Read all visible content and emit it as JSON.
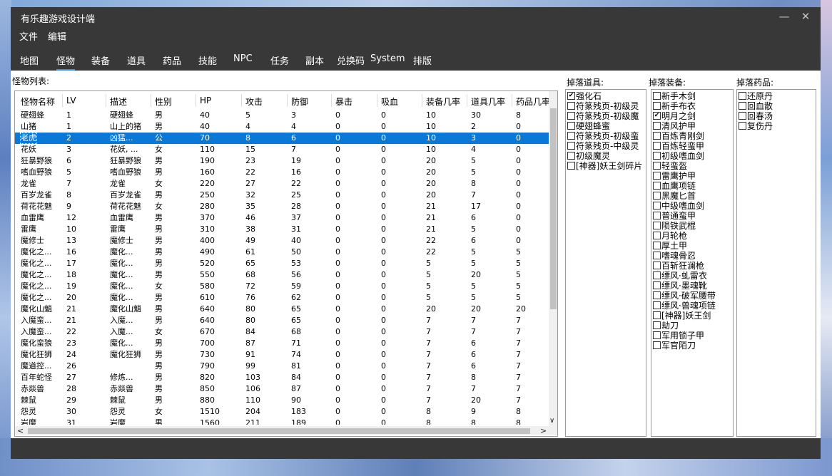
{
  "window": {
    "title": "有乐趣游戏设计端"
  },
  "menu": [
    "文件",
    "编辑"
  ],
  "tabs": [
    {
      "label": "地图",
      "active": false
    },
    {
      "label": "怪物",
      "active": true
    },
    {
      "label": "装备",
      "active": false
    },
    {
      "label": "道具",
      "active": false
    },
    {
      "label": "药品",
      "active": false
    },
    {
      "label": "技能",
      "active": false
    },
    {
      "label": "NPC",
      "active": false
    },
    {
      "label": "任务",
      "active": false
    },
    {
      "label": "副本",
      "active": false
    },
    {
      "label": "兑换码",
      "active": false
    },
    {
      "label": "System",
      "active": false
    },
    {
      "label": "排版",
      "active": false
    }
  ],
  "monster_list": {
    "label": "怪物列表:",
    "columns": [
      "怪物名称",
      "LV",
      "描述",
      "性别",
      "HP",
      "攻击",
      "防御",
      "暴击",
      "吸血",
      "装备几率",
      "道具几率",
      "药品几率"
    ],
    "selected_row": 2,
    "rows": [
      [
        "硬翅蜂",
        "1",
        "硬翅蜂",
        "男",
        "40",
        "5",
        "3",
        "0",
        "0",
        "10",
        "30",
        "8"
      ],
      [
        "山猪",
        "1",
        "山上的猪",
        "男",
        "40",
        "4",
        "4",
        "0",
        "0",
        "10",
        "2",
        "0"
      ],
      [
        "老虎",
        "2",
        "凶猛...",
        "公",
        "70",
        "8",
        "6",
        "0",
        "0",
        "10",
        "3",
        "0"
      ],
      [
        "花妖",
        "3",
        "花妖, ...",
        "女",
        "110",
        "15",
        "7",
        "0",
        "0",
        "10",
        "4",
        "0"
      ],
      [
        "狂暴野狼",
        "6",
        "狂暴野狼",
        "男",
        "190",
        "23",
        "19",
        "0",
        "0",
        "20",
        "5",
        "0"
      ],
      [
        "嗜血野狼",
        "5",
        "嗜血野狼",
        "男",
        "160",
        "22",
        "16",
        "0",
        "0",
        "20",
        "5",
        "0"
      ],
      [
        "龙雀",
        "7",
        "龙雀",
        "女",
        "220",
        "27",
        "22",
        "0",
        "0",
        "20",
        "8",
        "0"
      ],
      [
        "百岁龙雀",
        "8",
        "百岁龙雀",
        "男",
        "250",
        "32",
        "25",
        "0",
        "0",
        "20",
        "7",
        "0"
      ],
      [
        "荷花花魅",
        "9",
        "荷花花魅",
        "女",
        "280",
        "35",
        "28",
        "0",
        "0",
        "21",
        "17",
        "0"
      ],
      [
        "血雷鹰",
        "12",
        "血雷鹰",
        "男",
        "370",
        "46",
        "37",
        "0",
        "0",
        "21",
        "6",
        "0"
      ],
      [
        "雷鹰",
        "10",
        "雷鹰",
        "男",
        "310",
        "38",
        "31",
        "0",
        "0",
        "21",
        "5",
        "0"
      ],
      [
        "魔修士",
        "13",
        "魔修士",
        "男",
        "400",
        "49",
        "40",
        "0",
        "0",
        "22",
        "6",
        "0"
      ],
      [
        "魔化之...",
        "16",
        "魔化...",
        "男",
        "490",
        "61",
        "50",
        "0",
        "0",
        "22",
        "5",
        "5"
      ],
      [
        "魔化之...",
        "17",
        "魔化...",
        "男",
        "520",
        "65",
        "53",
        "0",
        "0",
        "5",
        "5",
        "5"
      ],
      [
        "魔化之...",
        "18",
        "魔化...",
        "男",
        "550",
        "68",
        "56",
        "0",
        "0",
        "5",
        "20",
        "5"
      ],
      [
        "魔化之...",
        "19",
        "魔化...",
        "女",
        "580",
        "72",
        "59",
        "0",
        "0",
        "5",
        "5",
        "5"
      ],
      [
        "魔化之...",
        "20",
        "魔化...",
        "男",
        "610",
        "76",
        "62",
        "0",
        "0",
        "5",
        "5",
        "5"
      ],
      [
        "魔化山魈",
        "21",
        "魔化山魈",
        "男",
        "640",
        "80",
        "65",
        "0",
        "0",
        "20",
        "20",
        "20"
      ],
      [
        "入魔蛮...",
        "21",
        "入魔...",
        "男",
        "640",
        "80",
        "65",
        "0",
        "0",
        "7",
        "7",
        "7"
      ],
      [
        "入魔蛮...",
        "22",
        "入魔...",
        "女",
        "670",
        "84",
        "68",
        "0",
        "0",
        "7",
        "7",
        "7"
      ],
      [
        "魔化蛮狼",
        "23",
        "魔化...",
        "男",
        "700",
        "87",
        "71",
        "0",
        "0",
        "7",
        "6",
        "7"
      ],
      [
        "魔化狂狮",
        "24",
        "魔化狂狮",
        "男",
        "730",
        "91",
        "74",
        "0",
        "0",
        "7",
        "6",
        "7"
      ],
      [
        "魔道控...",
        "26",
        "",
        "男",
        "790",
        "99",
        "81",
        "0",
        "0",
        "7",
        "6",
        "7"
      ],
      [
        "百年蛇怪",
        "27",
        "修炼...",
        "男",
        "820",
        "103",
        "84",
        "0",
        "0",
        "7",
        "8",
        "7"
      ],
      [
        "赤燚兽",
        "28",
        "赤燚兽",
        "男",
        "850",
        "106",
        "87",
        "0",
        "0",
        "7",
        "7",
        "7"
      ],
      [
        "棘鼠",
        "29",
        "棘鼠",
        "男",
        "880",
        "110",
        "90",
        "0",
        "0",
        "7",
        "20",
        "7"
      ],
      [
        "怨灵",
        "30",
        "怨灵",
        "女",
        "1510",
        "204",
        "183",
        "0",
        "0",
        "8",
        "9",
        "8"
      ],
      [
        "岩魔",
        "31",
        "岩魔",
        "男",
        "1560",
        "211",
        "189",
        "0",
        "0",
        "8",
        "8",
        "8"
      ]
    ]
  },
  "drop_items": {
    "label": "掉落道具:",
    "items": [
      {
        "label": "强化石",
        "checked": true
      },
      {
        "label": "符篆残页-初级灵",
        "checked": false
      },
      {
        "label": "符篆残页-初级魔",
        "checked": false
      },
      {
        "label": "硬翅蜂蜜",
        "checked": false
      },
      {
        "label": "符篆残页-初级蛮",
        "checked": false
      },
      {
        "label": "符篆残页-中级灵",
        "checked": false
      },
      {
        "label": "初级魔灵",
        "checked": false
      },
      {
        "label": "[神器]妖王剑碎片",
        "checked": false
      }
    ]
  },
  "drop_equipment": {
    "label": "掉落装备:",
    "items": [
      {
        "label": "新手木剑",
        "checked": false
      },
      {
        "label": "新手布衣",
        "checked": false
      },
      {
        "label": "明月之剑",
        "checked": true
      },
      {
        "label": "清风护甲",
        "checked": false
      },
      {
        "label": "百炼青刚剑",
        "checked": false
      },
      {
        "label": "百炼轻蛮甲",
        "checked": false
      },
      {
        "label": "初级嗜血剑",
        "checked": false
      },
      {
        "label": "轻蛮盔",
        "checked": false
      },
      {
        "label": "雷鹰护甲",
        "checked": false
      },
      {
        "label": "血鹰项链",
        "checked": false
      },
      {
        "label": "黑魔匕首",
        "checked": false
      },
      {
        "label": "中级嗜血剑",
        "checked": false
      },
      {
        "label": "普通蛮甲",
        "checked": false
      },
      {
        "label": "陨铁武棍",
        "checked": false
      },
      {
        "label": "月轮枪",
        "checked": false
      },
      {
        "label": "厚土甲",
        "checked": false
      },
      {
        "label": "嗜魂骨忍",
        "checked": false
      },
      {
        "label": "百斩狂澜枪",
        "checked": false
      },
      {
        "label": "缥风·虬雷衣",
        "checked": false
      },
      {
        "label": "缥风·墨魂靴",
        "checked": false
      },
      {
        "label": "缥风·破军腰带",
        "checked": false
      },
      {
        "label": "缥风·兽魂项链",
        "checked": false
      },
      {
        "label": "[神器]妖王剑",
        "checked": false
      },
      {
        "label": "劫刀",
        "checked": false
      },
      {
        "label": "军用锁子甲",
        "checked": false
      },
      {
        "label": "军官陌刀",
        "checked": false
      }
    ]
  },
  "drop_potions": {
    "label": "掉落药品:",
    "items": [
      {
        "label": "还原丹",
        "checked": false
      },
      {
        "label": "回血散",
        "checked": false
      },
      {
        "label": "回春汤",
        "checked": false
      },
      {
        "label": "复伤丹",
        "checked": false
      }
    ]
  }
}
